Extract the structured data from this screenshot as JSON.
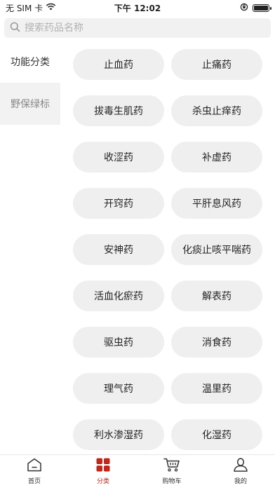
{
  "status_bar": {
    "carrier": "无 SIM 卡",
    "time": "下午 12:02"
  },
  "search": {
    "placeholder": "搜索药品名称"
  },
  "sidebar": {
    "items": [
      {
        "label": "功能分类"
      },
      {
        "label": "野保绿标"
      }
    ]
  },
  "categories": [
    "止血药",
    "止痛药",
    "拔毒生肌药",
    "杀虫止痒药",
    "收涩药",
    "补虚药",
    "开窍药",
    "平肝息风药",
    "安神药",
    "化痰止咳平喘药",
    "活血化瘀药",
    "解表药",
    "驱虫药",
    "消食药",
    "理气药",
    "温里药",
    "利水渗湿药",
    "化湿药"
  ],
  "tab_bar": {
    "items": [
      {
        "label": "首页"
      },
      {
        "label": "分类"
      },
      {
        "label": "购物车"
      },
      {
        "label": "我的"
      }
    ]
  },
  "colors": {
    "accent": "#c2271b",
    "chip_bg": "#efefef",
    "sidebar_inactive_bg": "#f2f2f2"
  },
  "icons": [
    "wifi-icon",
    "orientation-lock-icon",
    "battery-icon",
    "search-icon",
    "home-icon",
    "category-icon",
    "cart-icon",
    "profile-icon"
  ]
}
